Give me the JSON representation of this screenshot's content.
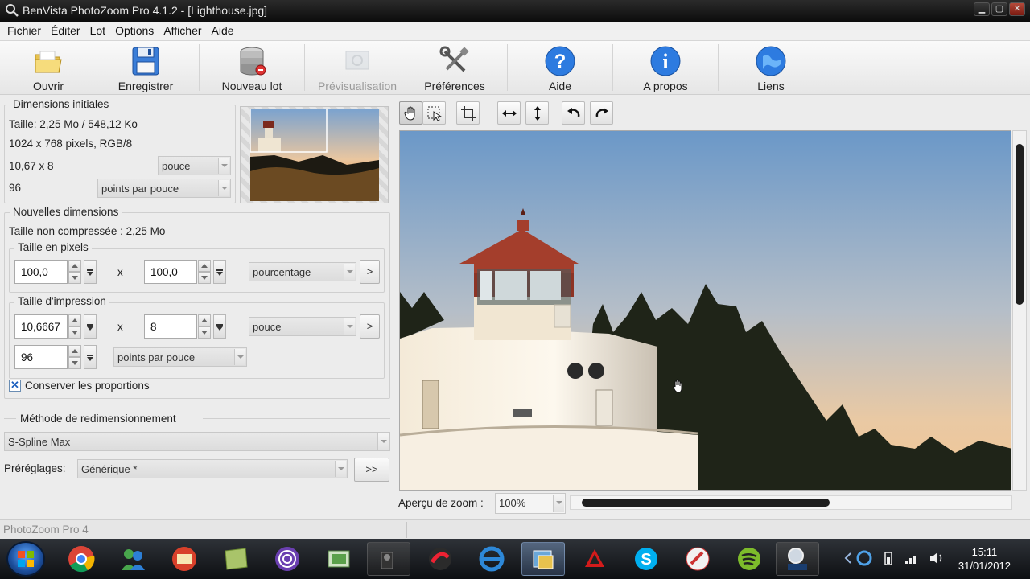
{
  "window": {
    "title": "BenVista PhotoZoom Pro 4.1.2 - [Lighthouse.jpg]",
    "controls": [
      "minimize-icon",
      "maximize-icon",
      "close-icon"
    ]
  },
  "menu": [
    "Fichier",
    "Éditer",
    "Lot",
    "Options",
    "Afficher",
    "Aide"
  ],
  "toolbar": {
    "open": "Ouvrir",
    "save": "Enregistrer",
    "new_batch": "Nouveau lot",
    "preview": "Prévisualisation",
    "preferences": "Préférences",
    "help": "Aide",
    "about": "A propos",
    "links": "Liens"
  },
  "initial": {
    "legend": "Dimensions initiales",
    "size": "Taille: 2,25 Mo / 548,12 Ko",
    "pixels": "1024 x 768 pixels, RGB/8",
    "print_size": "10,67 x 8",
    "print_unit": "pouce",
    "resolution": "96",
    "resolution_unit": "points par pouce"
  },
  "new_dims": {
    "legend": "Nouvelles dimensions",
    "uncompressed": "Taille non compressée : 2,25 Mo",
    "pixels_legend": "Taille en pixels",
    "width_px": "100,0",
    "height_px": "100,0",
    "times": "x",
    "pixel_unit": "pourcentage",
    "more": ">",
    "print_legend": "Taille d'impression",
    "width_print": "10,6667",
    "height_print": "8",
    "times2": "x",
    "print_unit": "pouce",
    "more2": ">",
    "resolution": "96",
    "resolution_unit": "points par pouce",
    "keep_ratio": "Conserver les proportions",
    "keep_ratio_checked": true
  },
  "resize": {
    "legend": "Méthode de redimensionnement",
    "method": "S-Spline Max",
    "presets_label": "Préréglages:",
    "preset": "Générique *",
    "expand": ">>"
  },
  "view": {
    "tools": [
      "hand-icon",
      "select-zoom-icon",
      "crop-icon",
      "fit-width-icon",
      "fit-height-icon",
      "rotate-left-icon",
      "rotate-right-icon"
    ],
    "zoom_label": "Aperçu de zoom :",
    "zoom_value": "100%"
  },
  "status": {
    "text": "PhotoZoom Pro 4"
  },
  "taskbar": {
    "time": "15:11",
    "date": "31/01/2012",
    "pinned": [
      "chrome-icon",
      "messenger-icon",
      "mail-icon",
      "notes-icon",
      "torrent-icon",
      "media-icon",
      "camera-icon",
      "itunes-icon",
      "ie-icon",
      "photo-app-icon",
      "acrobat-icon",
      "skype-icon",
      "paint-icon",
      "spotify-icon",
      "photozoom-icon"
    ]
  },
  "colors": {
    "accent_blue": "#1e6fd0",
    "titlebar": "#151515",
    "sky_top": "#6b98c8",
    "sky_bottom": "#f0c896"
  }
}
